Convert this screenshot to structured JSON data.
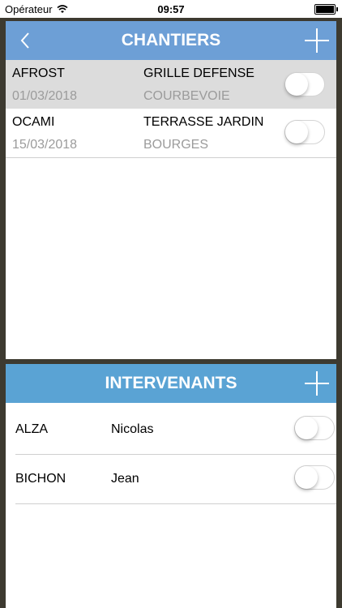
{
  "status_bar": {
    "carrier": "Opérateur",
    "time": "09:57"
  },
  "chantiers": {
    "title": "CHANTIERS",
    "rows": [
      {
        "client": "AFROST",
        "date": "01/03/2018",
        "name": "GRILLE DEFENSE",
        "city": "COURBEVOIE",
        "selected": true,
        "enabled": false
      },
      {
        "client": "OCAMI",
        "date": "15/03/2018",
        "name": "TERRASSE JARDIN",
        "city": "BOURGES",
        "selected": false,
        "enabled": false
      }
    ]
  },
  "intervenants": {
    "title": "INTERVENANTS",
    "rows": [
      {
        "last": "ALZA",
        "first": "Nicolas",
        "enabled": false
      },
      {
        "last": "BICHON",
        "first": "Jean",
        "enabled": false
      }
    ]
  },
  "colors": {
    "header1": "#6d9fd6",
    "header2": "#5aa3d4",
    "background": "#3d3a30"
  }
}
